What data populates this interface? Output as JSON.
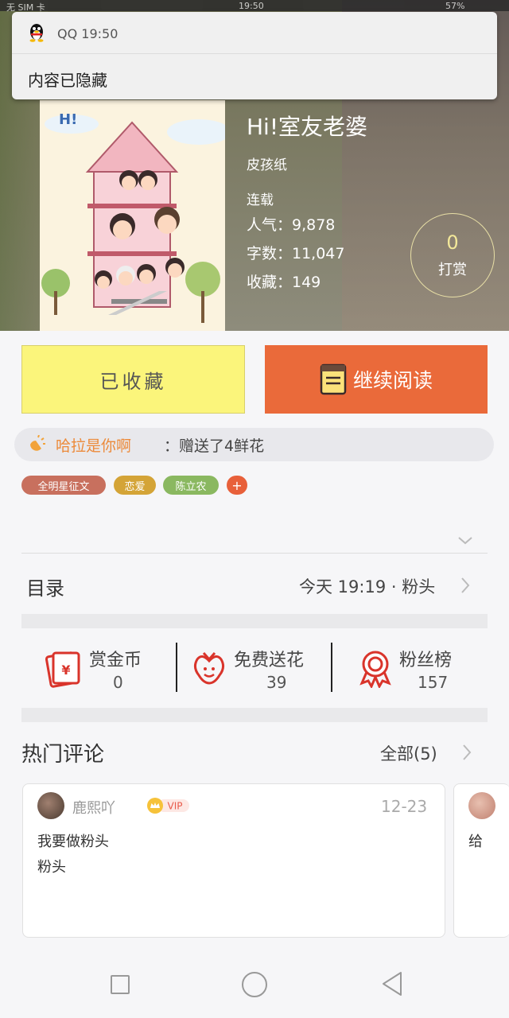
{
  "status_bar": {
    "left": "无 SIM 卡",
    "time": "19:50",
    "battery": "57%"
  },
  "notification": {
    "app_time": "QQ 19:50",
    "body": "内容已隐藏"
  },
  "book": {
    "title": "Hi!室友老婆",
    "author": "皮孩纸",
    "status": "连载",
    "popularity": "人气：9,878",
    "word_count": "字数：11,047",
    "favorites": "收藏：149",
    "reward_count": "0",
    "reward_label": "打赏"
  },
  "actions": {
    "favorited_label": "已收藏",
    "continue_label": "继续阅读"
  },
  "gift_message": {
    "user": "哈拉是你啊",
    "text": "：赠送了4鲜花"
  },
  "tags": [
    "全明星征文",
    "恋爱",
    "陈立农",
    "+"
  ],
  "toc": {
    "label": "目录",
    "latest": "今天 19:19 · 粉头"
  },
  "stats": [
    {
      "icon": "red-envelope-icon",
      "label": "赏金币",
      "value": "0"
    },
    {
      "icon": "flower-icon",
      "label": "免费送花",
      "value": "39"
    },
    {
      "icon": "ribbon-medal-icon",
      "label": "粉丝榜",
      "value": "157"
    }
  ],
  "hot_comments": {
    "title": "热门评论",
    "all_label": "全部(5)",
    "items": [
      {
        "user": "鹿熙吖",
        "badge": "VIP",
        "date": "12-23",
        "lines": [
          "我要做粉头",
          "粉头"
        ]
      },
      {
        "text": "给"
      }
    ]
  },
  "colors": {
    "accent_orange": "#ea6a3a",
    "favorite_yellow": "#fbf57b",
    "gift_user": "#ec8a3a",
    "icon_red": "#d9342b"
  }
}
